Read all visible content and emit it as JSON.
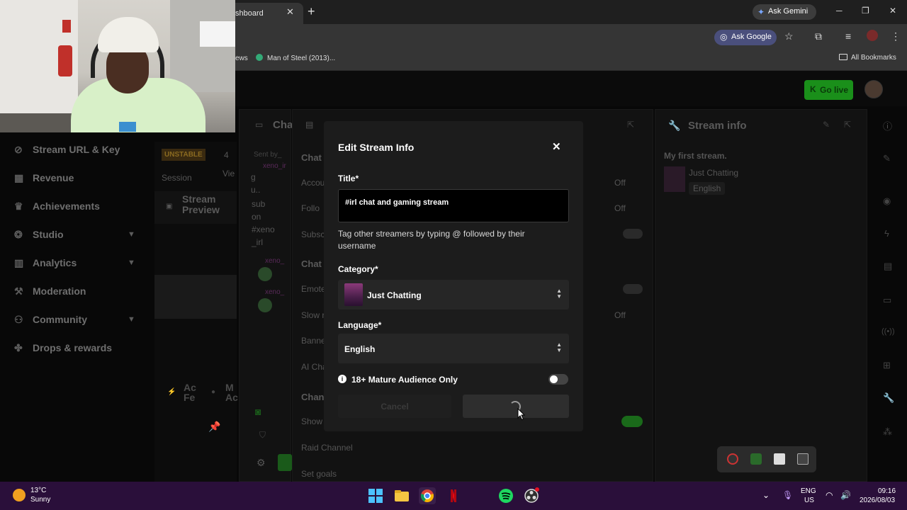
{
  "browser": {
    "active_tab_title": "shboard",
    "ask_gemini_label": "Ask Gemini",
    "ask_google_label": "Ask Google",
    "bookmarks": {
      "partial_item": "ews",
      "item_man_of_steel": "Man of Steel (2013)...",
      "all_bookmarks": "All Bookmarks"
    }
  },
  "header": {
    "go_live_label": "Go live"
  },
  "sidebar": {
    "items": [
      {
        "label": "Stream URL & Key",
        "icon": "link-icon"
      },
      {
        "label": "Revenue",
        "icon": "wallet-icon"
      },
      {
        "label": "Achievements",
        "icon": "trophy-icon"
      },
      {
        "label": "Studio",
        "icon": "studio-icon",
        "expandable": true
      },
      {
        "label": "Analytics",
        "icon": "chart-icon",
        "expandable": true
      },
      {
        "label": "Moderation",
        "icon": "wrench-icon"
      },
      {
        "label": "Community",
        "icon": "people-icon",
        "expandable": true
      },
      {
        "label": "Drops & rewards",
        "icon": "gift-icon"
      }
    ]
  },
  "background": {
    "unstable_badge": "UNSTABLE",
    "viewer_count": "4",
    "session_label": "Session",
    "views_label": "Vie",
    "stream_preview_label": "Stream Preview",
    "chat_panel_title": "Cha",
    "chat_sent_by": "Sent by_",
    "chat_user1": "xeno_ir",
    "chat_msg_fragment": [
      "g",
      "u..",
      "sub",
      "on",
      "#xeno",
      "_irl"
    ],
    "chat_user2": "xeno_",
    "chat_user3": "xeno_",
    "chat_settings_items": [
      "Chat",
      "Accou",
      "Follo",
      "Subsc",
      "Chat",
      "Emote",
      "Slow r",
      "Banne",
      "AI Cha",
      "Chan",
      "Show"
    ],
    "off_labels": [
      "Off",
      "Off",
      "Off"
    ],
    "raid_channel": "Raid Channel",
    "set_goals": "Set goals",
    "activity_feed": "Ac Fe",
    "mod_actions": "M Ac",
    "stream_info_title": "Stream info",
    "stream_info_title_text": "My first stream.",
    "stream_info_category": "Just Chatting",
    "stream_info_language": "English"
  },
  "modal": {
    "title": "Edit Stream Info",
    "title_label": "Title*",
    "title_value": "#irl chat and gaming stream",
    "title_help": "Tag other streamers by typing @ followed by their username",
    "category_label": "Category*",
    "category_value": "Just Chatting",
    "language_label": "Language*",
    "language_value": "English",
    "mature_label": "18+ Mature Audience Only",
    "mature_enabled": false,
    "cancel_label": "Cancel",
    "save_loading": true
  },
  "taskbar": {
    "weather_temp": "13°C",
    "weather_condition": "Sunny",
    "lang_line1": "ENG",
    "lang_line2": "US",
    "time": "09:16",
    "date": "2026/08/03"
  },
  "colors": {
    "go_live": "#1a8f1a",
    "taskbar": "#2a0f3a",
    "modal_bg": "#1c1c1c"
  }
}
